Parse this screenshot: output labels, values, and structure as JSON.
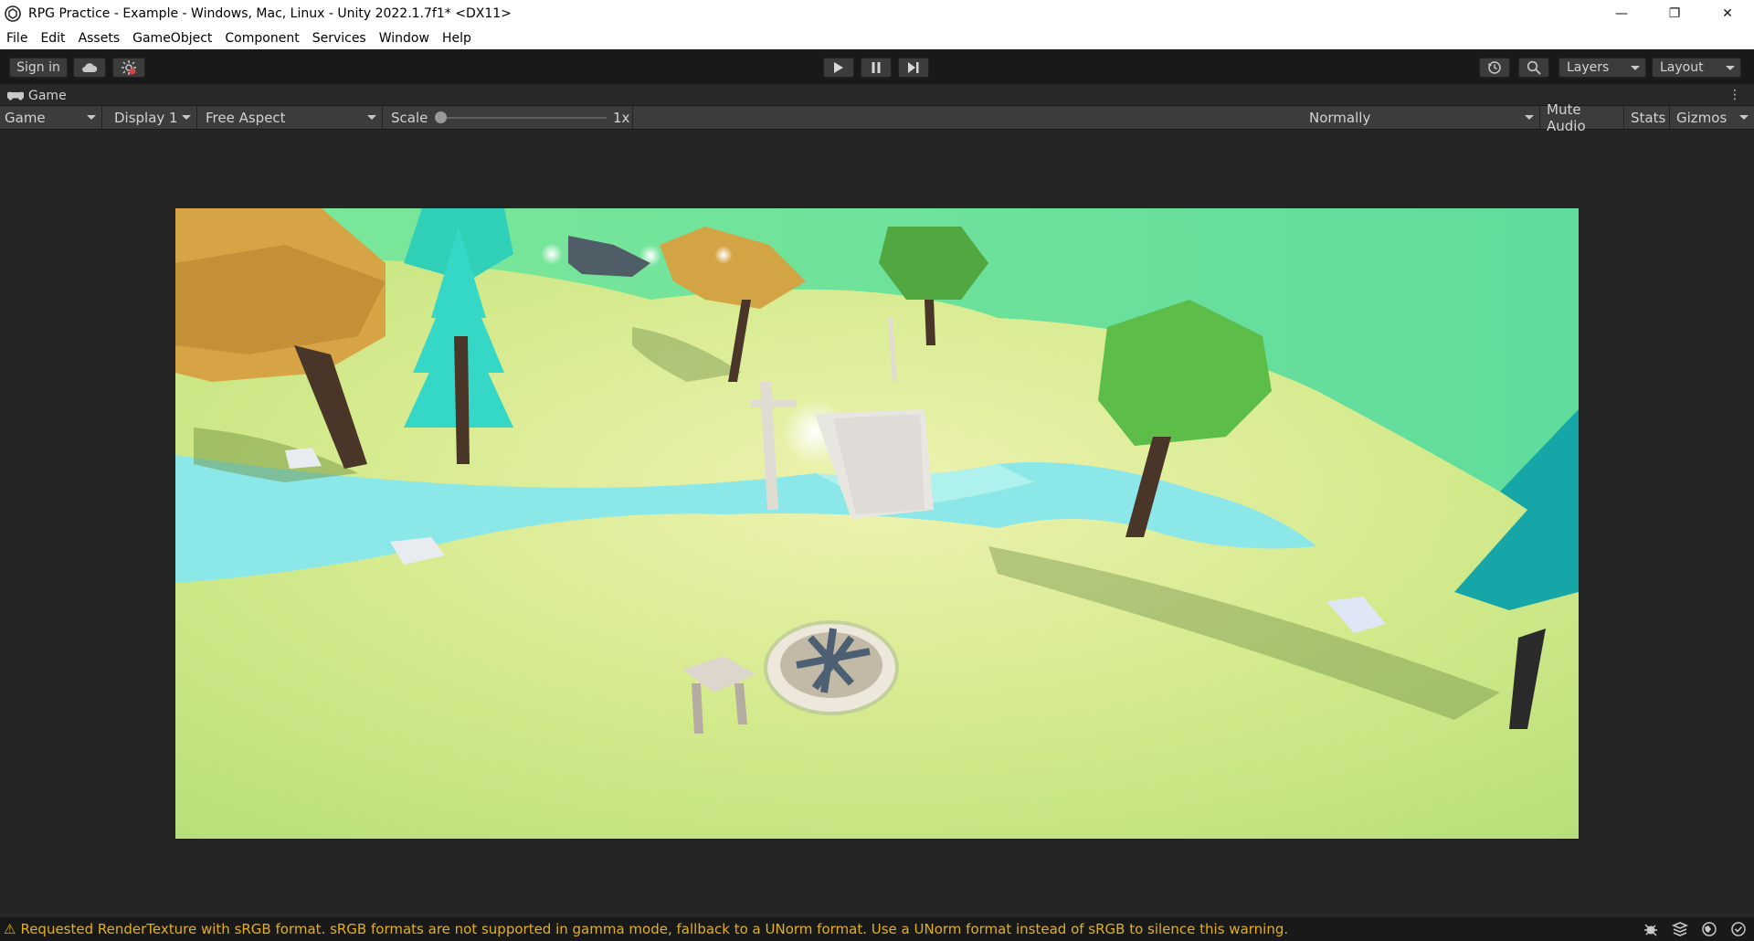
{
  "window": {
    "title": "RPG Practice - Example - Windows, Mac, Linux - Unity 2022.1.7f1* <DX11>",
    "controls": {
      "minimize": "—",
      "maximize": "❐",
      "close": "✕"
    }
  },
  "menu": [
    "File",
    "Edit",
    "Assets",
    "GameObject",
    "Component",
    "Services",
    "Window",
    "Help"
  ],
  "toolbar": {
    "sign_in": "Sign in",
    "layers": "Layers",
    "layout": "Layout"
  },
  "tab": {
    "label": "Game",
    "menu_glyph": "⋮"
  },
  "game_toolbar": {
    "mode": "Game",
    "display": "Display 1",
    "aspect": "Free Aspect",
    "scale_label": "Scale",
    "scale_value": "1x",
    "vsync": "Normally",
    "mute_audio": "Mute Audio",
    "stats": "Stats",
    "gizmos": "Gizmos"
  },
  "status": {
    "warning_icon": "⚠",
    "message": "Requested RenderTexture with sRGB format. sRGB formats are not supported in gamma mode, fallback to a UNorm format. Use a UNorm format instead of sRGB to silence this warning."
  },
  "colors": {
    "editor_bg": "#282828",
    "toolbar_bg": "#191919",
    "button_bg": "#3c3c3c",
    "warning": "#e0b020",
    "sky": "#6ee0a0",
    "grass": "#cfe68a",
    "river": "#8ce8e8"
  }
}
